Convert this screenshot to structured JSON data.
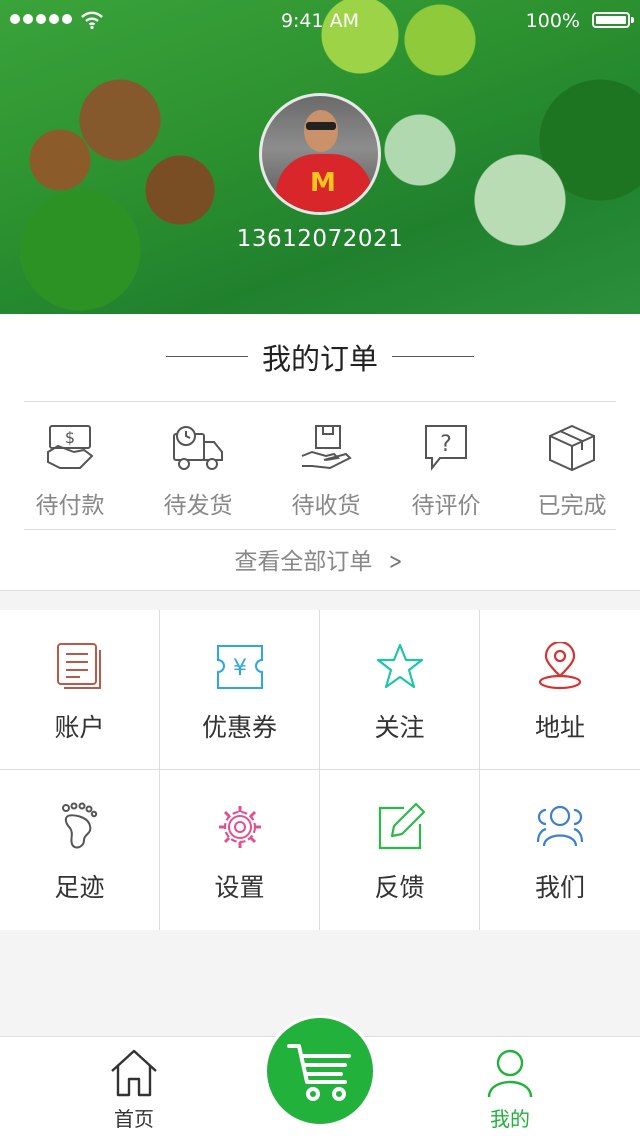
{
  "status_bar": {
    "time": "9:41 AM",
    "battery": "100%"
  },
  "profile": {
    "phone": "13612072021",
    "avatar_icon": "user-photo"
  },
  "orders": {
    "title": "我的订单",
    "items": [
      {
        "label": "待付款",
        "icon": "payment-icon"
      },
      {
        "label": "待发货",
        "icon": "truck-icon"
      },
      {
        "label": "待收货",
        "icon": "receive-box-icon"
      },
      {
        "label": "待评价",
        "icon": "review-icon"
      },
      {
        "label": "已完成",
        "icon": "package-icon"
      }
    ],
    "view_all": "查看全部订单"
  },
  "menu": [
    {
      "label": "账户",
      "icon": "document-icon",
      "color": "#b85a4a"
    },
    {
      "label": "优惠券",
      "icon": "coupon-icon",
      "color": "#2ea7e0"
    },
    {
      "label": "关注",
      "icon": "star-icon",
      "color": "#1fc5a8"
    },
    {
      "label": "地址",
      "icon": "location-pin-icon",
      "color": "#d93030"
    },
    {
      "label": "足迹",
      "icon": "footprint-icon",
      "color": "#555555"
    },
    {
      "label": "设置",
      "icon": "gear-icon",
      "color": "#e2508f"
    },
    {
      "label": "反馈",
      "icon": "edit-icon",
      "color": "#2db84a"
    },
    {
      "label": "我们",
      "icon": "users-icon",
      "color": "#3a7fd0"
    }
  ],
  "tabbar": {
    "home": "首页",
    "mine": "我的",
    "active_color": "#22b23c",
    "cart_icon": "cart-icon"
  }
}
